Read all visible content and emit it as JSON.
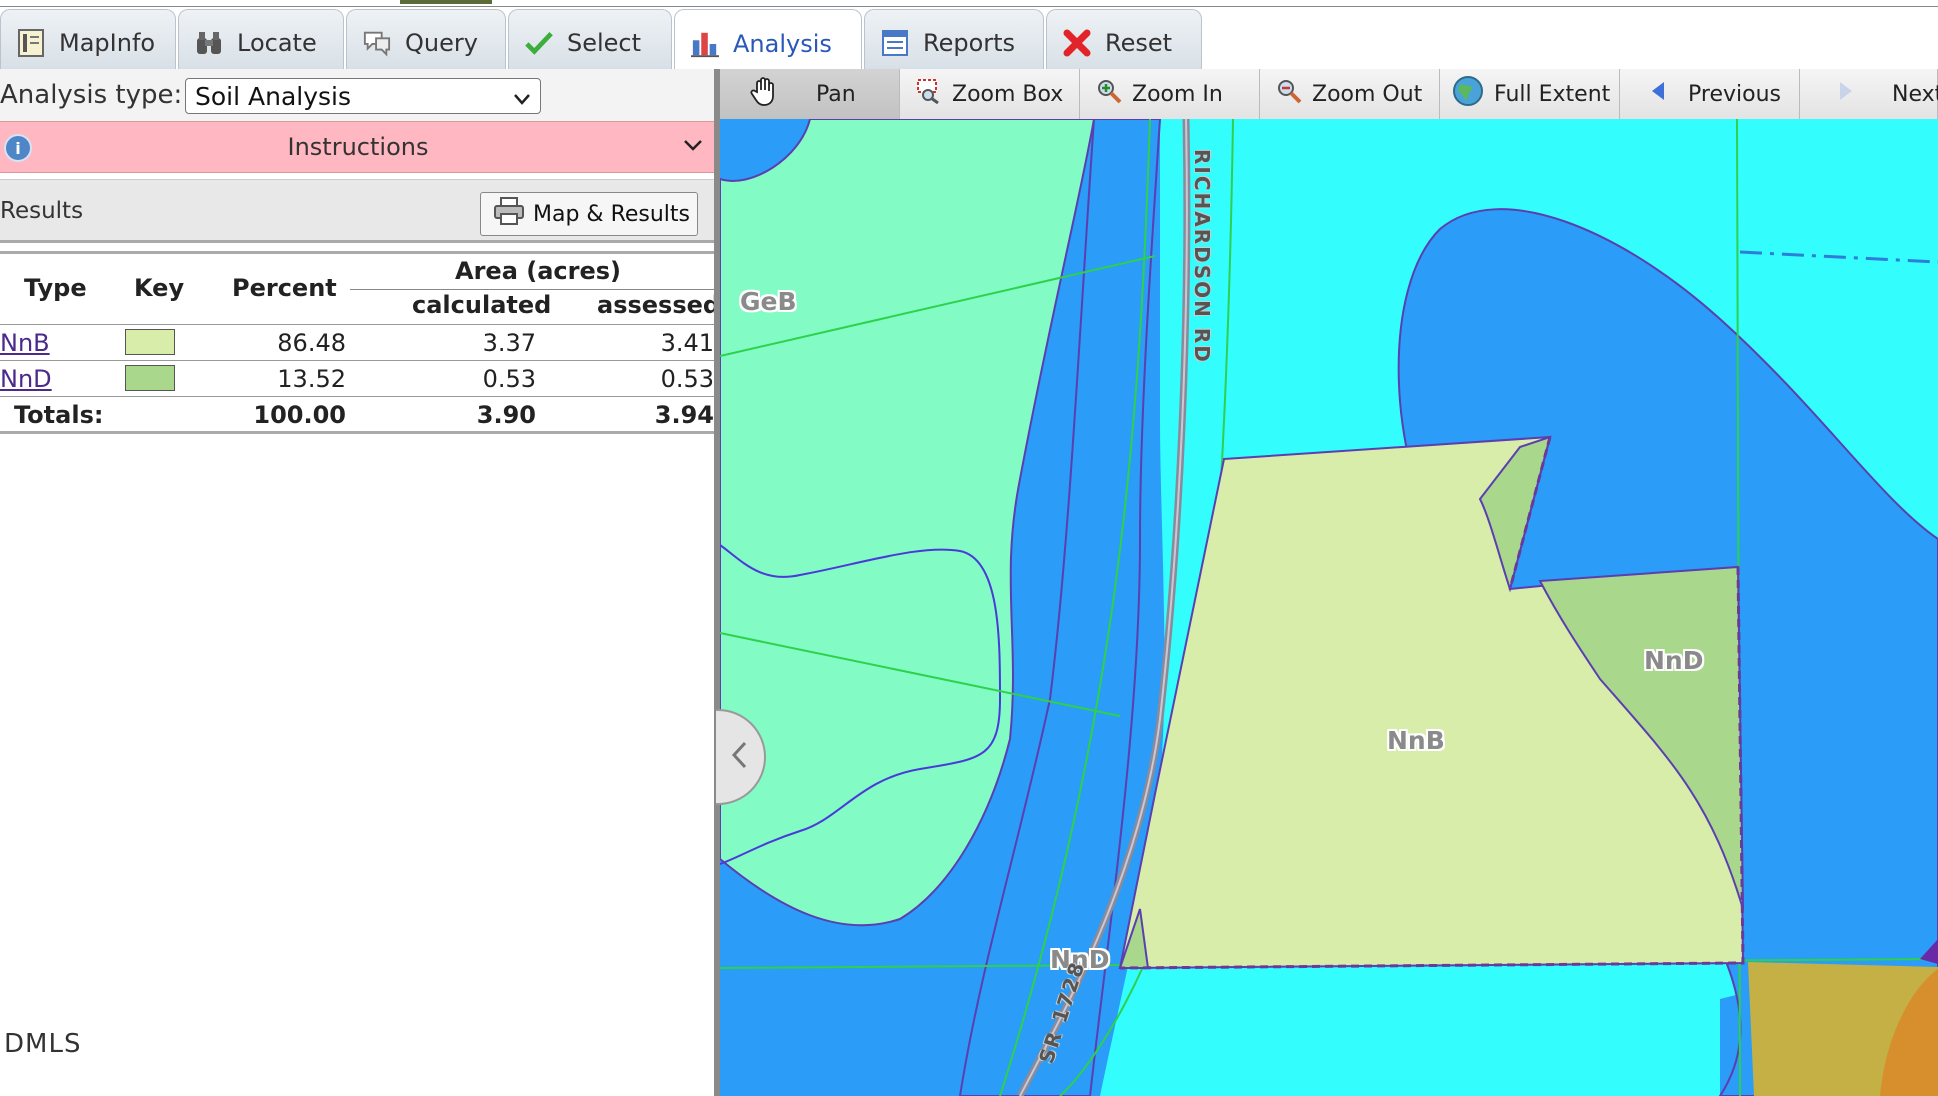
{
  "tabs": [
    {
      "label": "MapInfo",
      "icon": "map-info-icon"
    },
    {
      "label": "Locate",
      "icon": "binoculars-icon"
    },
    {
      "label": "Query",
      "icon": "speech-bubble-icon"
    },
    {
      "label": "Select",
      "icon": "checkmark-icon"
    },
    {
      "label": "Analysis",
      "icon": "bar-chart-icon"
    },
    {
      "label": "Reports",
      "icon": "report-icon"
    },
    {
      "label": "Reset",
      "icon": "red-x-icon"
    }
  ],
  "active_tab": "Analysis",
  "analysis": {
    "label": "Analysis type:",
    "selected": "Soil Analysis"
  },
  "instructions": {
    "label": "Instructions"
  },
  "results": {
    "label": "Results",
    "print_button": "Map & Results"
  },
  "table": {
    "headers": {
      "type": "Type",
      "key": "Key",
      "percent": "Percent",
      "area": "Area (acres)",
      "calculated": "calculated",
      "assessed": "assessed"
    },
    "rows": [
      {
        "type": "NnB",
        "key_color": "#d9edaa",
        "percent": "86.48",
        "calculated": "3.37",
        "assessed": "3.41"
      },
      {
        "type": "NnD",
        "key_color": "#a9d88c",
        "percent": "13.52",
        "calculated": "0.53",
        "assessed": "0.53"
      }
    ],
    "totals": {
      "label": "Totals:",
      "percent": "100.00",
      "calculated": "3.90",
      "assessed": "3.94"
    }
  },
  "watermark": "DMLS",
  "toolbar": [
    {
      "label": "Pan",
      "icon": "hand-icon"
    },
    {
      "label": "Zoom Box",
      "icon": "zoom-box-icon"
    },
    {
      "label": "Zoom In",
      "icon": "zoom-in-icon"
    },
    {
      "label": "Zoom Out",
      "icon": "zoom-out-icon"
    },
    {
      "label": "Full Extent",
      "icon": "globe-icon"
    },
    {
      "label": "Previous",
      "icon": "arrow-left-icon"
    },
    {
      "label": "Next",
      "icon": "arrow-right-icon"
    }
  ],
  "map": {
    "labels": {
      "geb": "GeB",
      "nnb": "NnB",
      "nnd_right": "NnD",
      "nnd_bottom": "NnD",
      "road": "RICHARDSON RD",
      "route": "SR 1728"
    },
    "colors": {
      "water_blue": "#2b9cf7",
      "cyan": "#33fdfd",
      "green_soil": "#82fbc5",
      "nnb_fill": "#d9edaa",
      "nnd_fill": "#a9d88c",
      "boundary": "#5b3fb0",
      "parcel_line": "#2ed14b"
    }
  }
}
